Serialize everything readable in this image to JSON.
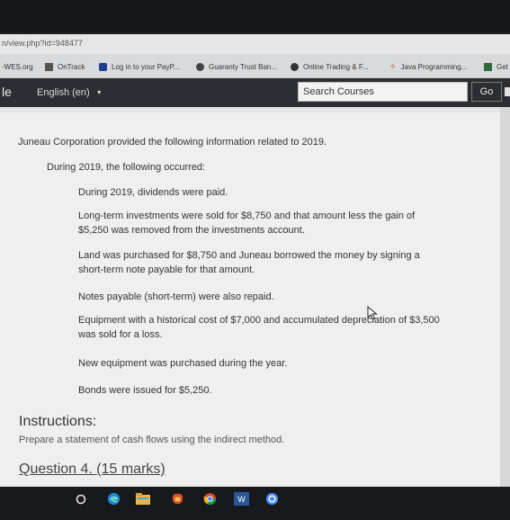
{
  "browser": {
    "url": "n/view.php?id=948477",
    "bookmarks": [
      {
        "label": "-WES.org",
        "icon": "none"
      },
      {
        "label": "OnTrack",
        "icon": "ontrack-icon"
      },
      {
        "label": "Log in to your PayP...",
        "icon": "paypal-icon"
      },
      {
        "label": "Guaranty Trust Ban...",
        "icon": "gtbank-icon"
      },
      {
        "label": "Online Trading & F...",
        "icon": "trading-icon"
      },
      {
        "label": "Java Programming...",
        "icon": "java-icon"
      },
      {
        "label": "Get",
        "icon": "app-icon"
      }
    ]
  },
  "site_header": {
    "brand": "le",
    "language": "English (en)",
    "search_placeholder": "Search Courses",
    "go_label": "Go"
  },
  "question": {
    "intro": "Juneau Corporation provided the following information related to 2019.",
    "during": "During 2019, the following occurred:",
    "items": [
      "During 2019, dividends were paid.",
      "Long-term investments were sold for $8,750 and that amount less the gain of $5,250 was removed from the investments account.",
      "Land was purchased for $8,750 and Juneau borrowed the money by signing a short-term note payable for that amount.",
      "Notes payable (short-term) were also repaid.",
      "Equipment with a historical cost of $7,000 and accumulated depreciation of $3,500 was sold for a loss.",
      "New equipment was purchased during the year.",
      "Bonds were issued for $5,250."
    ],
    "instructions_heading": "Instructions:",
    "instructions_text": "Prepare a statement of cash flows using the indirect method.",
    "next_question": "Question 4. (15 marks)"
  },
  "taskbar": {
    "icons": [
      "start-icon",
      "edge-icon",
      "file-explorer-icon",
      "store-icon",
      "chrome-icon",
      "word-icon",
      "app-icon"
    ]
  }
}
